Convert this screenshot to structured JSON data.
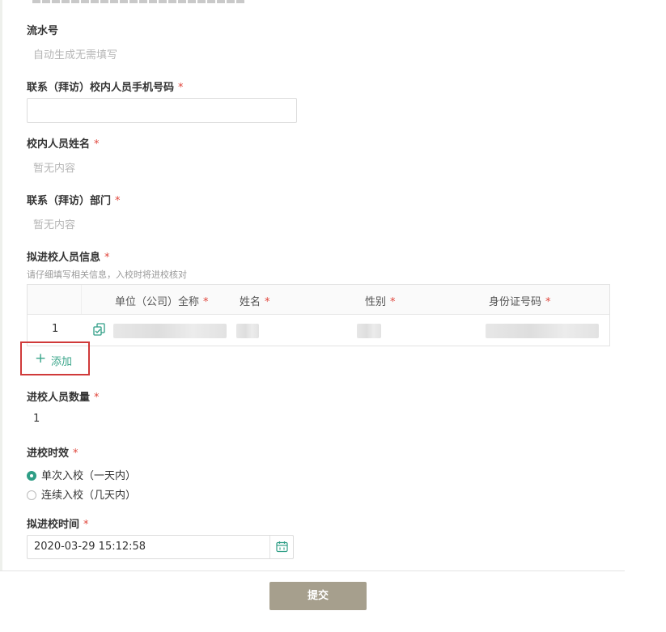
{
  "form": {
    "serial": {
      "label": "流水号",
      "placeholder": "自动生成无需填写"
    },
    "phone": {
      "label": "联系（拜访）校内人员手机号码",
      "required": "*",
      "value": ""
    },
    "staff_name": {
      "label": "校内人员姓名",
      "required": "*",
      "placeholder": "暂无内容"
    },
    "department": {
      "label": "联系（拜访）部门",
      "required": "*",
      "placeholder": "暂无内容"
    },
    "visitors": {
      "label": "拟进校人员信息",
      "required": "*",
      "hint": "请仔细填写相关信息，入校时将进校核对",
      "columns": [
        {
          "title": "单位（公司）全称",
          "required": "*"
        },
        {
          "title": "姓名",
          "required": "*"
        },
        {
          "title": "性别",
          "required": "*"
        },
        {
          "title": "身份证号码",
          "required": "*"
        }
      ],
      "rows": [
        {
          "index": "1"
        }
      ],
      "add_label": "添加",
      "add_plus": "+"
    },
    "count": {
      "label": "进校人员数量",
      "required": "*",
      "value": "1"
    },
    "validity": {
      "label": "进校时效",
      "required": "*",
      "options": [
        {
          "label": "单次入校（一天内）",
          "selected": true
        },
        {
          "label": "连续入校（几天内）",
          "selected": false
        }
      ]
    },
    "entry_time": {
      "label": "拟进校时间",
      "required": "*",
      "value": "2020-03-29 15:12:58"
    },
    "submit_label": "提交"
  },
  "colors": {
    "accent": "#2f9e86",
    "required": "#e0463c",
    "highlight_border": "#d03a3a",
    "submit_bg": "#a69f8d"
  },
  "icons": {
    "row_icon": "copy-doc-icon",
    "date_icon": "calendar-icon"
  }
}
